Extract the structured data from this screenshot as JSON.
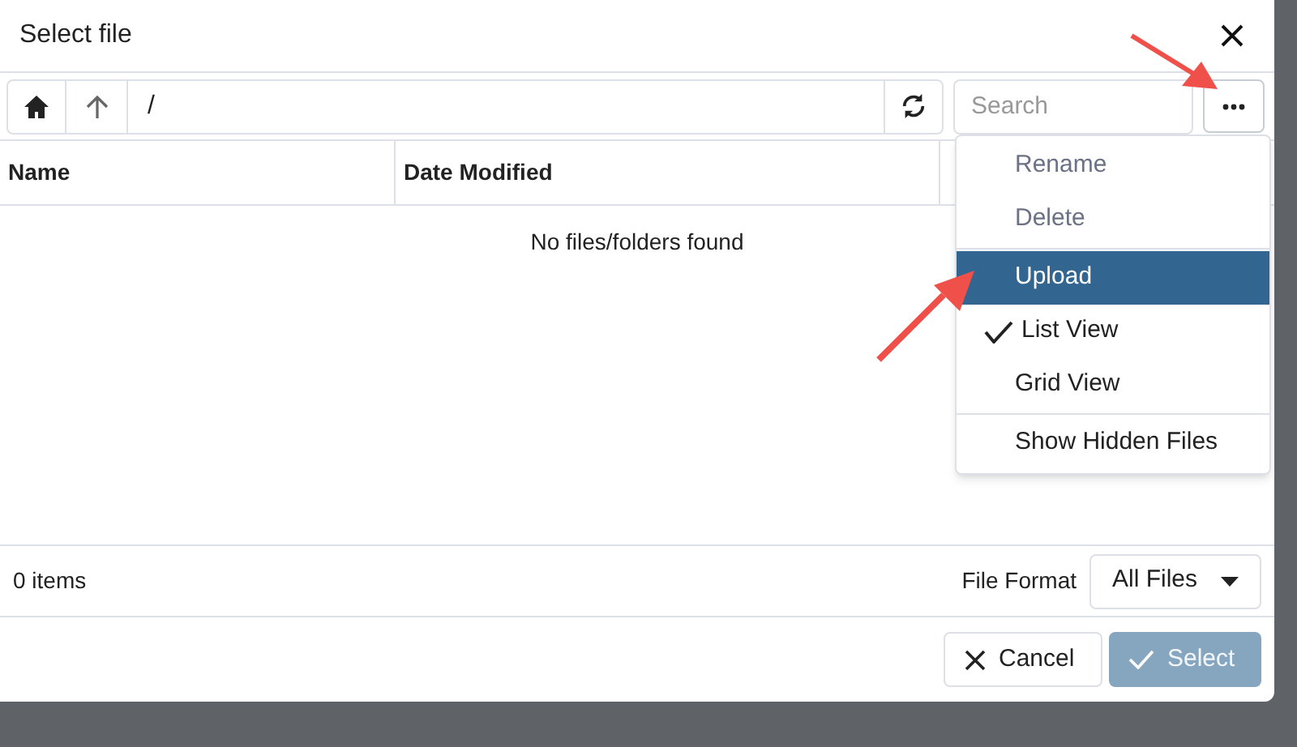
{
  "dialog": {
    "title": "Select file"
  },
  "toolbar": {
    "path": "/",
    "search": {
      "placeholder": "Search"
    }
  },
  "table": {
    "columns": [
      {
        "label": "Name"
      },
      {
        "label": "Date Modified"
      }
    ],
    "empty_message": "No files/folders found"
  },
  "menu": [
    {
      "label": "Rename",
      "disabled": true,
      "selected": false,
      "checked": false,
      "separator_above": false
    },
    {
      "label": "Delete",
      "disabled": true,
      "selected": false,
      "checked": false,
      "separator_above": false
    },
    {
      "label": "Upload",
      "disabled": false,
      "selected": true,
      "checked": false,
      "separator_above": true
    },
    {
      "label": "List View",
      "disabled": false,
      "selected": false,
      "checked": true,
      "separator_above": false
    },
    {
      "label": "Grid View",
      "disabled": false,
      "selected": false,
      "checked": false,
      "separator_above": false
    },
    {
      "label": "Show Hidden Files",
      "disabled": false,
      "selected": false,
      "checked": false,
      "separator_above": true
    }
  ],
  "footer": {
    "count": "0 items",
    "format_label": "File Format",
    "format_value": "All Files"
  },
  "buttons": [
    {
      "label": "Cancel",
      "kind": "cancel",
      "disabled": false
    },
    {
      "label": "Select",
      "kind": "select",
      "disabled": true
    }
  ]
}
